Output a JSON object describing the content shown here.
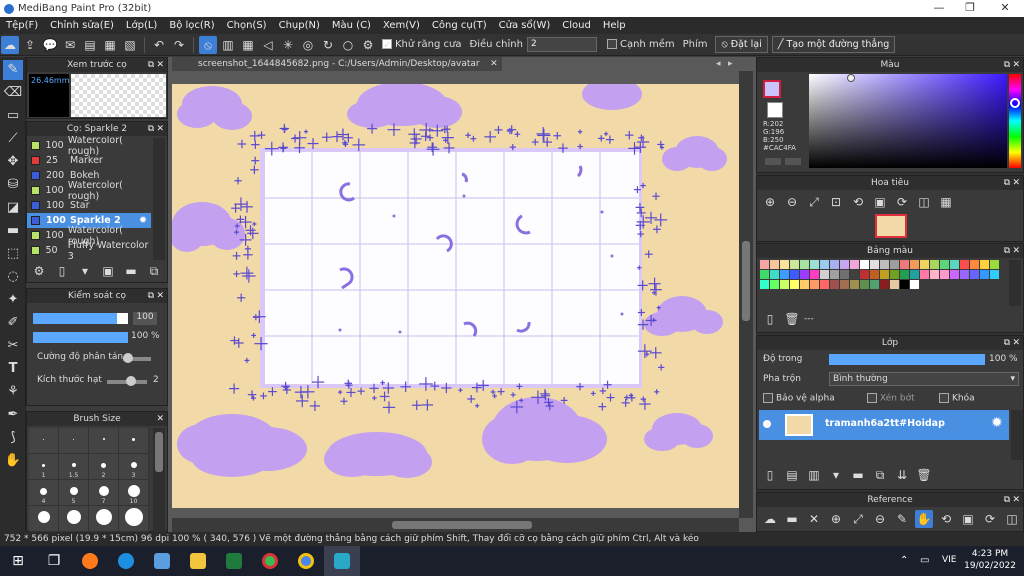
{
  "window": {
    "title": "MediBang Paint Pro (32bit)",
    "minimize": "—",
    "restore": "❐",
    "close": "✕"
  },
  "menu": [
    "Tệp(F)",
    "Chỉnh sửa(E)",
    "Lớp(L)",
    "Bộ lọc(R)",
    "Chọn(S)",
    "Chụp(N)",
    "Màu (C)",
    "Xem(V)",
    "Công cụ(T)",
    "Cửa sổ(W)",
    "Cloud",
    "Help"
  ],
  "toolbar": {
    "antialias_label": "Khử răng cưa",
    "adjust_label": "Điều chỉnh",
    "adjust_value": "2",
    "edge_label": "Cạnh mềm",
    "key_label": "Phím",
    "reset_label": "Đặt lại",
    "line_label": "Tạo một đường thẳng"
  },
  "preview": {
    "title": "Xem trước cọ",
    "size": "26.46mm"
  },
  "brush": {
    "title": "Cọ: Sparkle 2",
    "items": [
      {
        "size": "100",
        "name": "Watercolor( rough)",
        "color": "#b7e36a"
      },
      {
        "size": "25",
        "name": "Marker",
        "color": "#e33a3a"
      },
      {
        "size": "200",
        "name": "Bokeh",
        "color": "#3a5ed8"
      },
      {
        "size": "100",
        "name": "Watercolor( rough)",
        "color": "#b7e36a"
      },
      {
        "size": "100",
        "name": "Star",
        "color": "#3a5ed8"
      },
      {
        "size": "100",
        "name": "Sparkle 2",
        "color": "#3a5ed8"
      },
      {
        "size": "100",
        "name": "Watercolor( rough)",
        "color": "#b7e36a"
      },
      {
        "size": "50",
        "name": "Fluffy Watercolor 3",
        "color": "#b7e36a"
      }
    ],
    "selected_index": 5
  },
  "brush_control": {
    "title": "Kiểm soát cọ",
    "size_value": "100",
    "opacity_value": "100 %",
    "scatter_label": "Cường độ phân tán",
    "particle_label": "Kích thước hạt",
    "particle_value": "2"
  },
  "brush_size": {
    "title": "Brush Size",
    "labels": [
      "1",
      "1.5",
      "2",
      "3",
      "4",
      "5",
      "7",
      "10"
    ]
  },
  "canvas_tab": "screenshot_1644845682.png - C:/Users/Admin/Desktop/avatar",
  "color_panel": {
    "title": "Màu",
    "r": "R:202",
    "g": "G:196",
    "b": "B:250",
    "hex": "#CAC4FA",
    "current": "#cac4fa"
  },
  "navigator_title": "Hoa tiêu",
  "palette": {
    "title": "Bảng màu",
    "footer": "---",
    "colors": [
      "#f4a6a6",
      "#f6c59a",
      "#f7e49a",
      "#cde79b",
      "#a6e3a1",
      "#9ee0d3",
      "#9cc9f0",
      "#a9b0f2",
      "#c7a6f0",
      "#f0a6d9",
      "#ffffff",
      "#e0e0e0",
      "#bdbdbd",
      "#9e9e9e",
      "#f07878",
      "#f09a5c",
      "#f0d35c",
      "#a8d65c",
      "#5cd67a",
      "#5cd6c0",
      "#ff4d4d",
      "#ff8a3d",
      "#ffd23d",
      "#9bdc3d",
      "#3ddc6a",
      "#3ddcc6",
      "#3d9cff",
      "#3d5cff",
      "#9b3dff",
      "#ff3dc0",
      "#d0d0d0",
      "#a0a0a0",
      "#707070",
      "#404040",
      "#c03030",
      "#c06020",
      "#c0a020",
      "#70a020",
      "#20a050",
      "#20a0a0",
      "#ff7aa8",
      "#ffb3c8",
      "#ff99cc",
      "#cc66ff",
      "#9966ff",
      "#6666ff",
      "#3399ff",
      "#33ccff",
      "#33ffcc",
      "#66ff66",
      "#ccff66",
      "#ffff66",
      "#ffcc66",
      "#ff9966",
      "#ff6666",
      "#a05050",
      "#a07050",
      "#a09050",
      "#609050",
      "#50a070",
      "#8a1e1e",
      "#e5c9a0",
      "#000000",
      "#ffffff"
    ]
  },
  "layers": {
    "title": "Lớp",
    "opacity_label": "Độ trong",
    "opacity_value": "100 %",
    "blend_label": "Pha trộn",
    "blend_value": "Bình thường",
    "alpha_label": "Bảo vệ alpha",
    "clip_label": "Xén bớt",
    "lock_label": "Khóa",
    "layer_name": "tramanh6a2tt#Hoidap"
  },
  "reference_title": "Reference",
  "status": "752 * 566 pixel   (19.9 * 15cm)   96 dpi   100 %   ( 340, 576 )   Vẽ một đường thẳng bằng cách giữ phím Shift, Thay đổi cỡ cọ bằng cách giữ phím Ctrl, Alt và kéo",
  "taskbar": {
    "lang": "VIE",
    "time": "4:23 PM",
    "date": "19/02/2022"
  }
}
